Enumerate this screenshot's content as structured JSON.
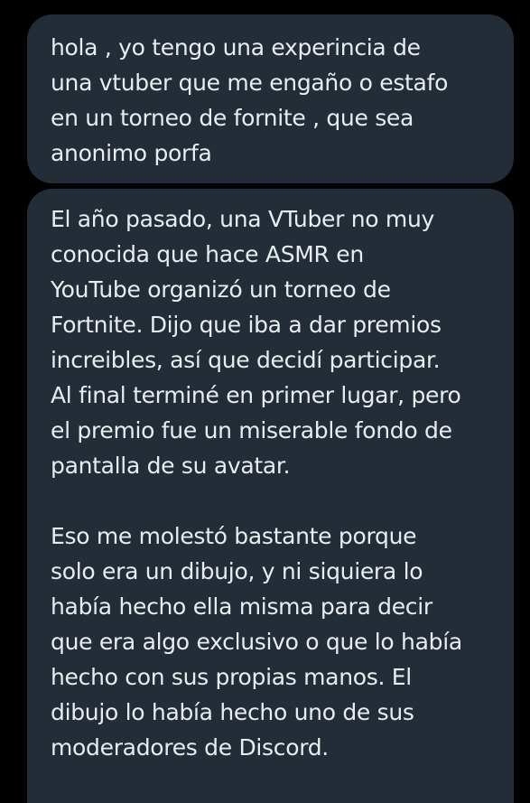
{
  "messages": [
    {
      "lines": [
        "hola , yo tengo una experincia de",
        "una vtuber que me engaño o estafo",
        "en un torneo de fornite , que sea",
        "anonimo porfa"
      ]
    },
    {
      "paragraph_1": [
        "El año pasado, una VTuber no muy",
        "conocida que hace ASMR en",
        "YouTube organizó un torneo de",
        "Fortnite. Dijo que iba a dar premios",
        "increibles, así que decidí participar.",
        "Al final terminé en primer lugar, pero",
        "el premio fue un miserable fondo de",
        "pantalla de su avatar."
      ],
      "paragraph_2": [
        "Eso me molestó bastante porque",
        "solo era un dibujo, y ni siquiera lo",
        "había hecho ella misma para decir",
        "que era algo exclusivo o que lo había",
        "hecho con sus propias manos. El",
        "dibujo lo había hecho uno de sus",
        "moderadores de Discord."
      ]
    }
  ],
  "colors": {
    "background": "#000000",
    "bubble": "#232d37",
    "text": "#e9ecef"
  }
}
